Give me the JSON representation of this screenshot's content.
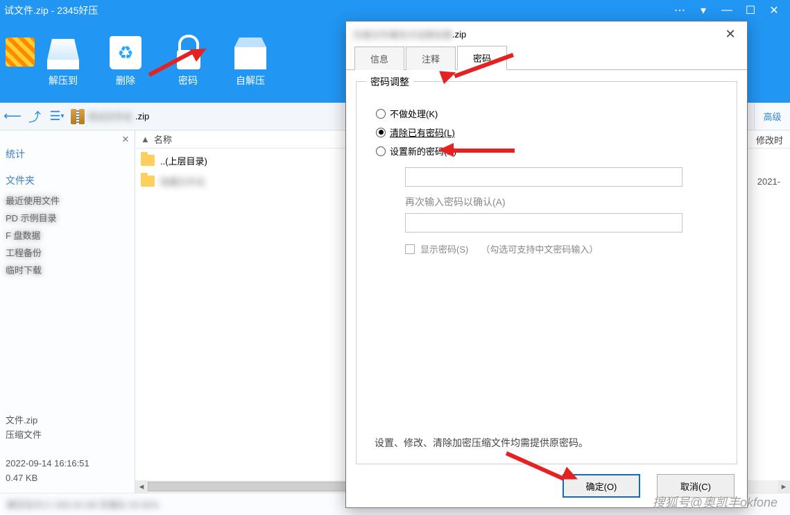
{
  "titlebar": {
    "text": "试文件.zip - 2345好压"
  },
  "toolbar": {
    "items": [
      {
        "label": ""
      },
      {
        "label": "解压到"
      },
      {
        "label": "删除"
      },
      {
        "label": "密码"
      },
      {
        "label": "自解压"
      }
    ]
  },
  "pathbar": {
    "file_ext": ".zip",
    "advanced": "高级"
  },
  "sidebar": {
    "stats_heading": "统计",
    "folder_heading": "文件夹",
    "footer_file": "文件.zip",
    "footer_type": "压缩文件",
    "footer_time": "2022-09-14 16:16:51",
    "footer_size": "0.47 KB"
  },
  "filegrid": {
    "col_name": "名称",
    "col_modtime": "修改时",
    "rows": [
      {
        "name": "..(上层目录)",
        "modtime": ""
      },
      {
        "name": "",
        "modtime": "2021-"
      }
    ]
  },
  "statusbar": {
    "text": ""
  },
  "dialog": {
    "title_ext": ".zip",
    "close": "✕",
    "tabs": {
      "info": "信息",
      "comment": "注释",
      "password": "密码"
    },
    "group_legend": "密码调整",
    "radio_none": "不做处理(K)",
    "radio_clear": "清除已有密码(L)",
    "radio_set": "设置新的密码(N)",
    "confirm_label": "再次输入密码以确认(A)",
    "show_pwd": "显示密码(S)",
    "show_pwd_hint": "（勾选可支持中文密码输入）",
    "note": "设置、修改、清除加密压缩文件均需提供原密码。",
    "ok": "确定(O)",
    "cancel": "取消(C)"
  },
  "watermark": "搜狐号@奥凯丰okfone"
}
